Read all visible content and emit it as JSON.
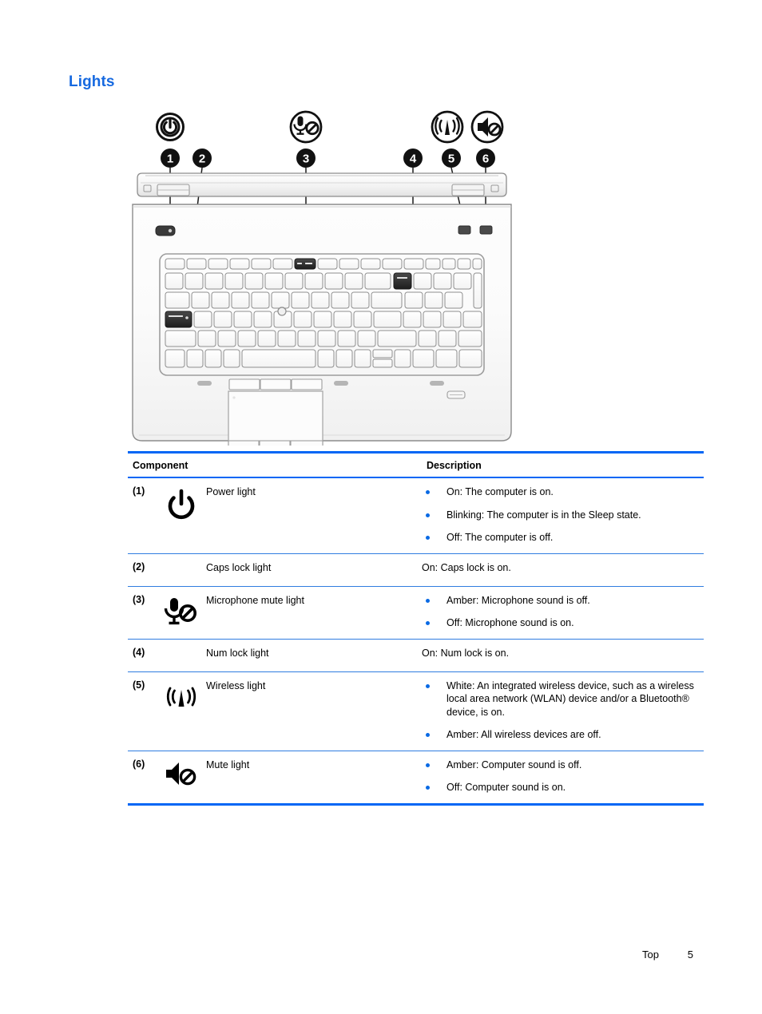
{
  "document": {
    "section_title": "Lights",
    "footer": {
      "label": "Top",
      "page_number": "5"
    }
  },
  "colors": {
    "heading_blue": "#1669e0",
    "rule_blue": "#0066f5",
    "bullet_blue": "#0a6ae4",
    "row_rule_blue": "#2f7de0"
  },
  "illustration": {
    "caption_icons": [
      {
        "id": "power-symbol-icon",
        "label": "power symbol"
      },
      {
        "id": "microphone-mute-icon",
        "label": "microphone mute"
      },
      {
        "id": "wireless-icon",
        "label": "wireless"
      },
      {
        "id": "mute-speaker-icon",
        "label": "mute"
      }
    ],
    "callouts": [
      "1",
      "2",
      "3",
      "4",
      "5",
      "6"
    ]
  },
  "table": {
    "headers": {
      "component": "Component",
      "description": "Description"
    },
    "rows": [
      {
        "number": "(1)",
        "icon": "power-symbol-icon",
        "name": "Power light",
        "bullets": [
          "On: The computer is on.",
          "Blinking: The computer is in the Sleep state.",
          "Off: The computer is off."
        ]
      },
      {
        "number": "(2)",
        "icon": "",
        "name": "Caps lock light",
        "plain": "On: Caps lock is on."
      },
      {
        "number": "(3)",
        "icon": "microphone-mute-icon",
        "name": "Microphone mute light",
        "bullets": [
          "Amber: Microphone sound is off.",
          "Off: Microphone sound is on."
        ]
      },
      {
        "number": "(4)",
        "icon": "",
        "name": "Num lock light",
        "plain": "On: Num lock is on."
      },
      {
        "number": "(5)",
        "icon": "wireless-icon",
        "name": "Wireless light",
        "bullets": [
          "White: An integrated wireless device, such as a wireless local area network (WLAN) device and/or a Bluetooth® device, is on.",
          "Amber: All wireless devices are off."
        ]
      },
      {
        "number": "(6)",
        "icon": "mute-speaker-icon",
        "name": "Mute light",
        "bullets": [
          "Amber: Computer sound is off.",
          "Off: Computer sound is on."
        ]
      }
    ]
  }
}
